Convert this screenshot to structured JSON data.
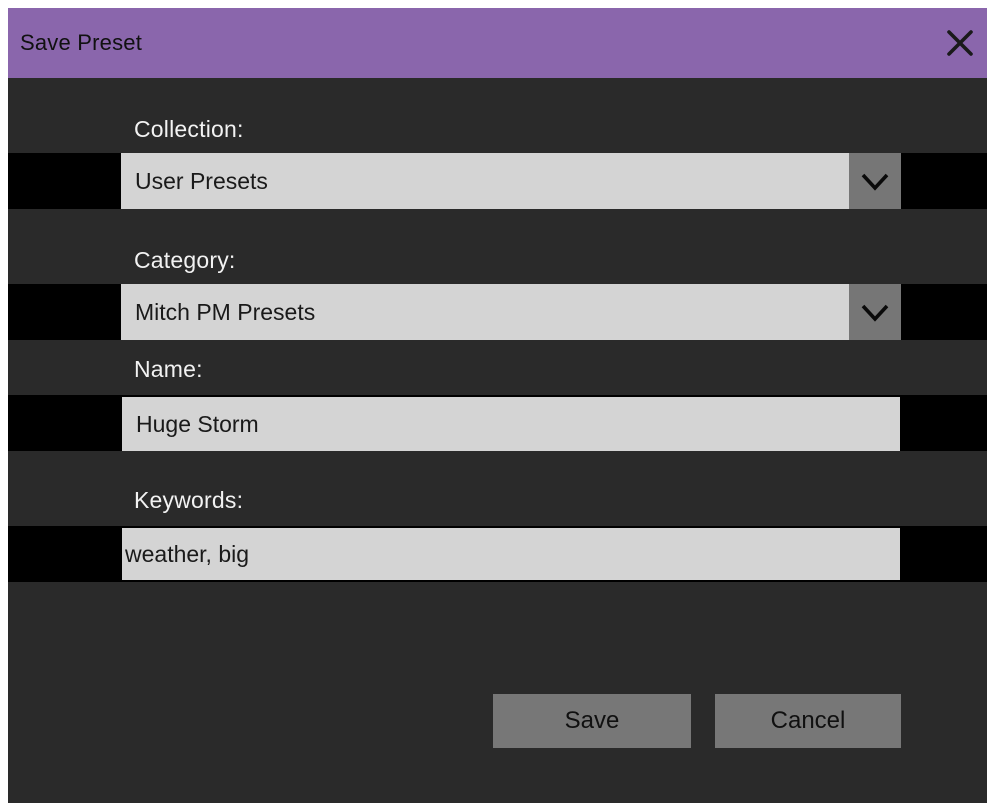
{
  "dialog": {
    "title": "Save Preset",
    "close_icon": "close-icon"
  },
  "form": {
    "collection": {
      "label": "Collection:",
      "value": "User Presets"
    },
    "category": {
      "label": "Category:",
      "value": "Mitch PM Presets"
    },
    "name": {
      "label": "Name:",
      "value": "Huge Storm"
    },
    "keywords": {
      "label": "Keywords:",
      "value": "weather, big"
    }
  },
  "buttons": {
    "save_label": "Save",
    "cancel_label": "Cancel"
  },
  "colors": {
    "titlebar": "#8a66ac",
    "background": "#2a2a2a",
    "field": "#d4d4d4",
    "button": "#777777"
  }
}
